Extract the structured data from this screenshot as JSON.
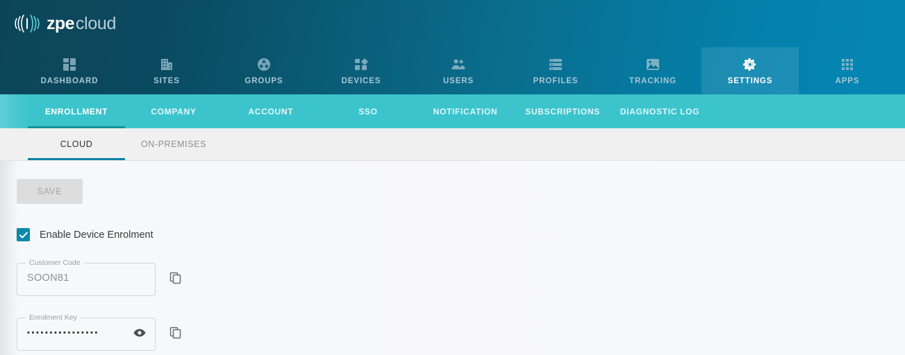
{
  "brand": {
    "name_bold": "zpe",
    "name_light": "cloud",
    "logo_icon": "zpe-waves-logo-icon",
    "header_gradient_from": "#0d4558",
    "header_gradient_to": "#0587b4"
  },
  "main_nav": {
    "items": [
      {
        "label": "DASHBOARD",
        "icon": "dashboard-grid-icon",
        "active": false
      },
      {
        "label": "SITES",
        "icon": "building-icon",
        "active": false
      },
      {
        "label": "GROUPS",
        "icon": "group-circle-icon",
        "active": false
      },
      {
        "label": "DEVICES",
        "icon": "devices-squares-icon",
        "active": false
      },
      {
        "label": "USERS",
        "icon": "users-people-icon",
        "active": false
      },
      {
        "label": "PROFILES",
        "icon": "profiles-list-icon",
        "active": false
      },
      {
        "label": "TRACKING",
        "icon": "tracking-map-image-icon",
        "active": false
      },
      {
        "label": "SETTINGS",
        "icon": "gear-icon",
        "active": true
      },
      {
        "label": "APPS",
        "icon": "apps-dots-grid-icon",
        "active": false
      }
    ]
  },
  "sub_nav": {
    "accent_color": "#3cc4cd",
    "active_underline_color": "#14919b",
    "items": [
      {
        "label": "ENROLLMENT",
        "active": true
      },
      {
        "label": "COMPANY",
        "active": false
      },
      {
        "label": "ACCOUNT",
        "active": false
      },
      {
        "label": "SSO",
        "active": false
      },
      {
        "label": "NOTIFICATION",
        "active": false
      },
      {
        "label": "SUBSCRIPTIONS",
        "active": false
      },
      {
        "label": "DIAGNOSTIC LOG",
        "active": false
      }
    ]
  },
  "level_tabs": {
    "active_underline_color": "#0883a5",
    "items": [
      {
        "label": "CLOUD",
        "active": true
      },
      {
        "label": "ON-PREMISES",
        "active": false
      }
    ]
  },
  "form": {
    "save_label": "SAVE",
    "save_disabled": true,
    "enable_enrolment": {
      "label": "Enable Device Enrolment",
      "checked": true,
      "checkbox_color": "#0d87a8",
      "icon": "checkmark-icon"
    },
    "customer_code": {
      "label": "Customer Code",
      "value": "SOON81",
      "copy_icon": "copy-icon"
    },
    "enrolment_key": {
      "label": "Enrolment Key",
      "value": "▪▪▪▪▪▪▪▪▪▪▪▪▪▪▪▪",
      "reveal_icon": "eye-icon",
      "copy_icon": "copy-icon"
    }
  }
}
